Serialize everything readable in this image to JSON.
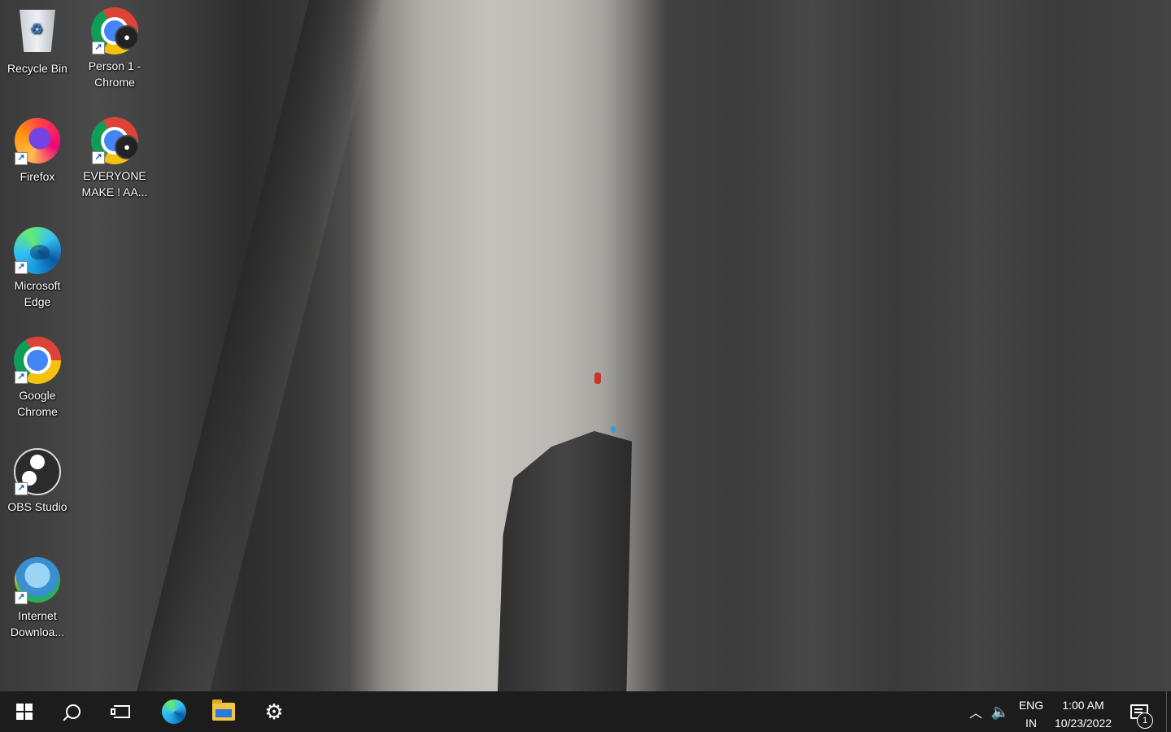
{
  "desktop": {
    "icons": [
      {
        "label": "Recycle Bin",
        "icon": "recycle-bin-icon"
      },
      {
        "label": "Person 1 -\nChrome",
        "icon": "chrome-icon"
      },
      {
        "label": "Firefox",
        "icon": "firefox-icon"
      },
      {
        "label": "EVERYONE\nMAKE ! AA...",
        "icon": "chrome-icon"
      },
      {
        "label": "Microsoft\nEdge",
        "icon": "edge-icon"
      },
      {
        "label": "Google\nChrome",
        "icon": "chrome-icon"
      },
      {
        "label": "OBS Studio",
        "icon": "obs-icon"
      },
      {
        "label": "Internet\nDownloa...",
        "icon": "internet-download-manager-icon"
      }
    ]
  },
  "taskbar": {
    "pinned": [
      "start-icon",
      "search-icon",
      "task-view-icon",
      "edge-icon",
      "file-explorer-icon",
      "settings-icon"
    ],
    "tray": {
      "language_top": "ENG",
      "language_bottom": "IN",
      "time": "1:00 AM",
      "date": "10/23/2022",
      "notification_count": "1"
    }
  },
  "colors": {
    "taskbar_bg": "#1c1c1c",
    "climber_red": "#c0392b",
    "climber_blue": "#3498db"
  }
}
